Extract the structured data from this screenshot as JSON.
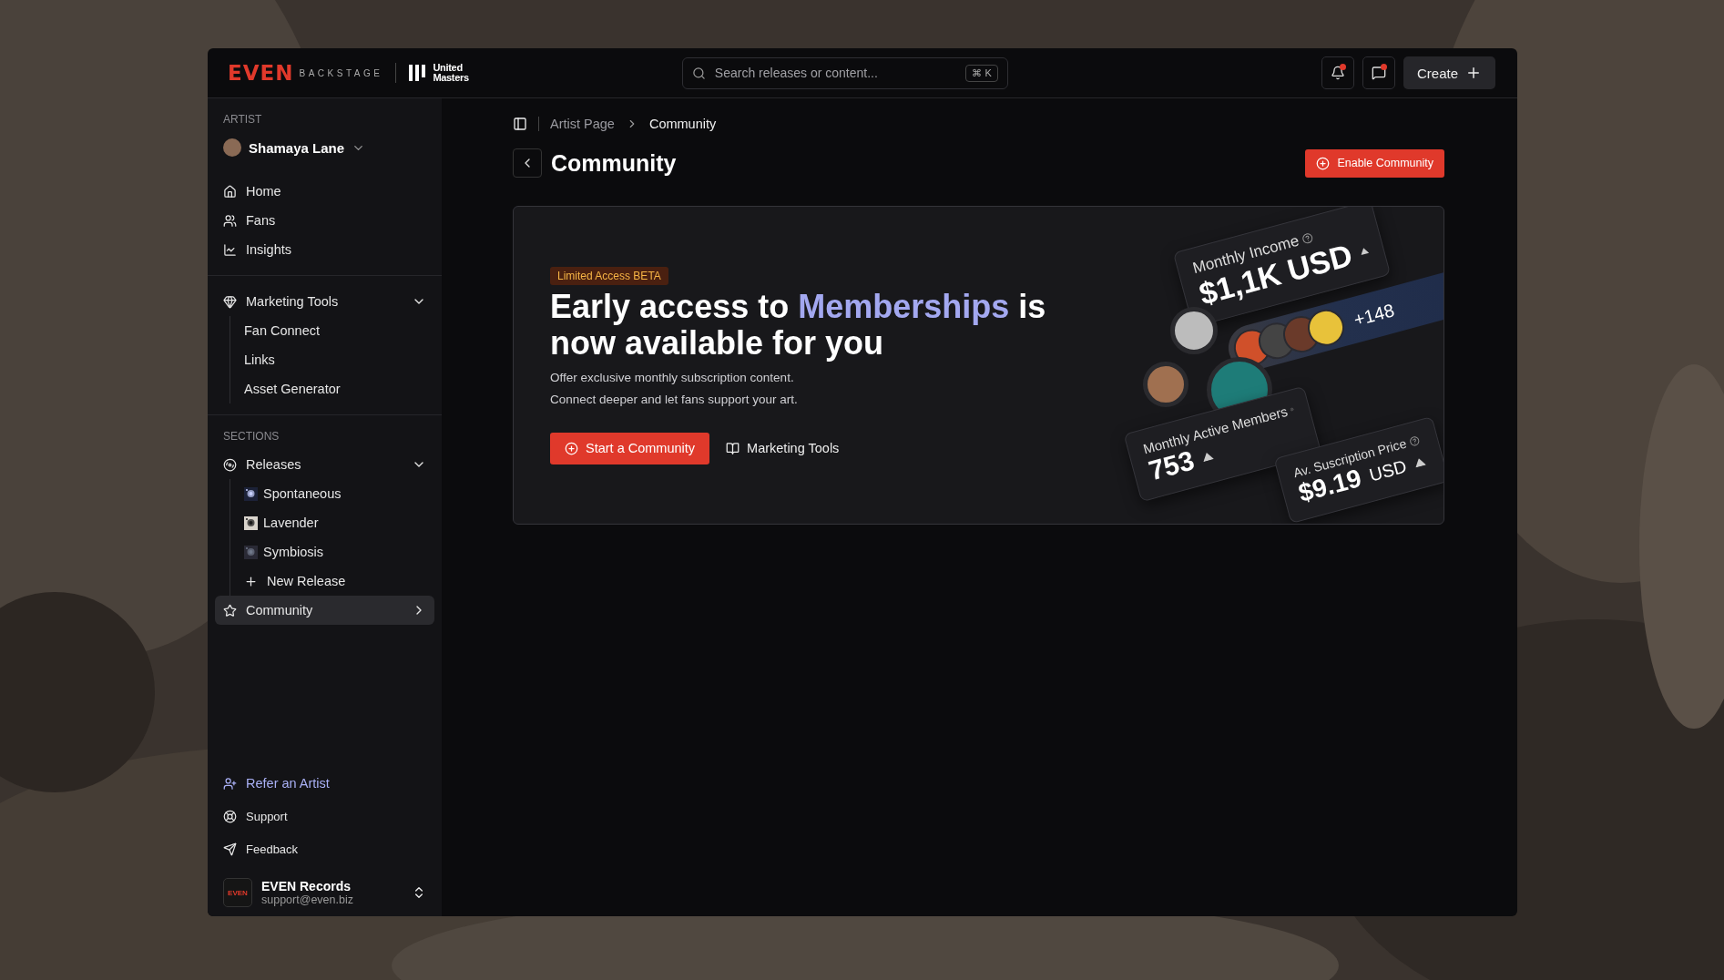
{
  "brand": {
    "logo": "EVEN",
    "sub": "BACKSTAGE",
    "partner": [
      "United",
      "Masters"
    ]
  },
  "search": {
    "placeholder": "Search releases or content...",
    "shortcut": [
      "⌘",
      "K"
    ]
  },
  "top_actions": {
    "notifications_unread": true,
    "messages_unread": true,
    "create": "Create"
  },
  "sidebar": {
    "artist_label": "ARTIST",
    "artist": "Shamaya Lane",
    "nav": [
      {
        "label": "Home"
      },
      {
        "label": "Fans"
      },
      {
        "label": "Insights"
      }
    ],
    "marketing": {
      "label": "Marketing Tools",
      "expanded": true,
      "children": [
        {
          "label": "Fan Connect"
        },
        {
          "label": "Links"
        },
        {
          "label": "Asset Generator"
        }
      ]
    },
    "sections_label": "SECTIONS",
    "releases": {
      "label": "Releases",
      "expanded": true,
      "children": [
        {
          "label": "Spontaneous",
          "kind": "release"
        },
        {
          "label": "Lavender",
          "kind": "release"
        },
        {
          "label": "Symbiosis",
          "kind": "release"
        },
        {
          "label": "New Release",
          "kind": "add"
        }
      ]
    },
    "community": {
      "label": "Community",
      "selected": true
    },
    "footer": [
      {
        "label": "Refer an Artist",
        "accent": true
      },
      {
        "label": "Support",
        "accent": false
      },
      {
        "label": "Feedback",
        "accent": false
      }
    ],
    "account": {
      "logo": "EVEN",
      "name": "EVEN Records",
      "email": "support@even.biz"
    }
  },
  "breadcrumb": [
    "Artist Page",
    "Community"
  ],
  "page": {
    "title": "Community",
    "action": "Enable Community"
  },
  "promo": {
    "badge": "Limited Access BETA",
    "heading_before": "Early access to ",
    "heading_highlight": "Memberships",
    "heading_after": " is now available for you",
    "lines": [
      "Offer exclusive monthly subscription content.",
      "Connect deeper and let fans support your art."
    ],
    "primary": "Start a Community",
    "secondary": "Marketing Tools",
    "stats": [
      {
        "label": "Monthly Income",
        "value": "$1,1K USD"
      },
      {
        "label": "Monthly Active Members",
        "value": "753"
      },
      {
        "label": "Av. Suscription Price",
        "value": "$9.19",
        "unit": "USD"
      }
    ],
    "more_members": "+148"
  }
}
